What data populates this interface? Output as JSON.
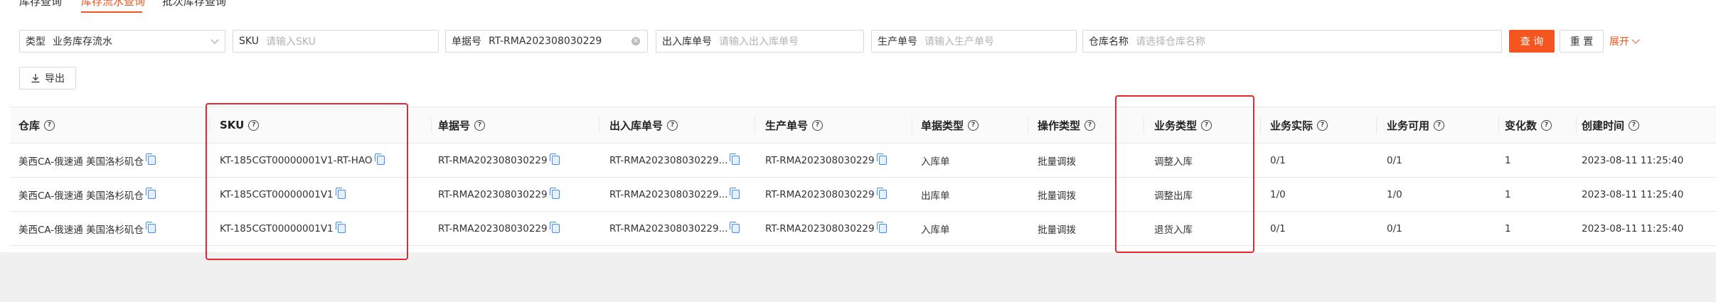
{
  "tabs": [
    {
      "label": "库存查询"
    },
    {
      "label": "库存流水查询"
    },
    {
      "label": "批次库存查询"
    }
  ],
  "filters": {
    "type": {
      "label": "类型",
      "value": "业务库存流水"
    },
    "sku": {
      "label": "SKU",
      "placeholder": "请输入SKU"
    },
    "doc_no": {
      "label": "单据号",
      "value": "RT-RMA202308030229"
    },
    "io_no": {
      "label": "出入库单号",
      "placeholder": "请输入出入库单号"
    },
    "prod_no": {
      "label": "生产单号",
      "placeholder": "请输入生产单号"
    },
    "warehouse": {
      "label": "仓库名称",
      "placeholder": "请选择仓库名称"
    }
  },
  "actions": {
    "query": "查 询",
    "reset": "重 置",
    "expand": "展开",
    "export": "导出"
  },
  "table": {
    "headers": [
      "仓库",
      "SKU",
      "单据号",
      "出入库单号",
      "生产单号",
      "单据类型",
      "操作类型",
      "业务类型",
      "业务实际",
      "业务可用",
      "变化数",
      "创建时间"
    ],
    "rows": [
      {
        "warehouse": "美西CA-俄速通 美国洛杉矶仓",
        "sku": "KT-185CGT00000001V1-RT-HAO",
        "doc_no": "RT-RMA202308030229",
        "io_no": "RT-RMA202308030229...",
        "prod_no": "RT-RMA202308030229",
        "doc_type": "入库单",
        "op_type": "批量调拨",
        "biz_type": "调整入库",
        "actual": "0/1",
        "available": "0/1",
        "change": "1",
        "created": "2023-08-11 11:25:40"
      },
      {
        "warehouse": "美西CA-俄速通 美国洛杉矶仓",
        "sku": "KT-185CGT00000001V1",
        "doc_no": "RT-RMA202308030229",
        "io_no": "RT-RMA202308030229...",
        "prod_no": "RT-RMA202308030229",
        "doc_type": "出库单",
        "op_type": "批量调拨",
        "biz_type": "调整出库",
        "actual": "1/0",
        "available": "1/0",
        "change": "1",
        "created": "2023-08-11 11:25:40"
      },
      {
        "warehouse": "美西CA-俄速通 美国洛杉矶仓",
        "sku": "KT-185CGT00000001V1",
        "doc_no": "RT-RMA202308030229",
        "io_no": "RT-RMA202308030229...",
        "prod_no": "RT-RMA202308030229",
        "doc_type": "入库单",
        "op_type": "批量调拨",
        "biz_type": "退货入库",
        "actual": "0/1",
        "available": "0/1",
        "change": "1",
        "created": "2023-08-11 11:25:40"
      }
    ]
  },
  "colors": {
    "accent": "#f5551f",
    "highlight": "#e8262f",
    "copy_icon": "#3d8bfd"
  }
}
